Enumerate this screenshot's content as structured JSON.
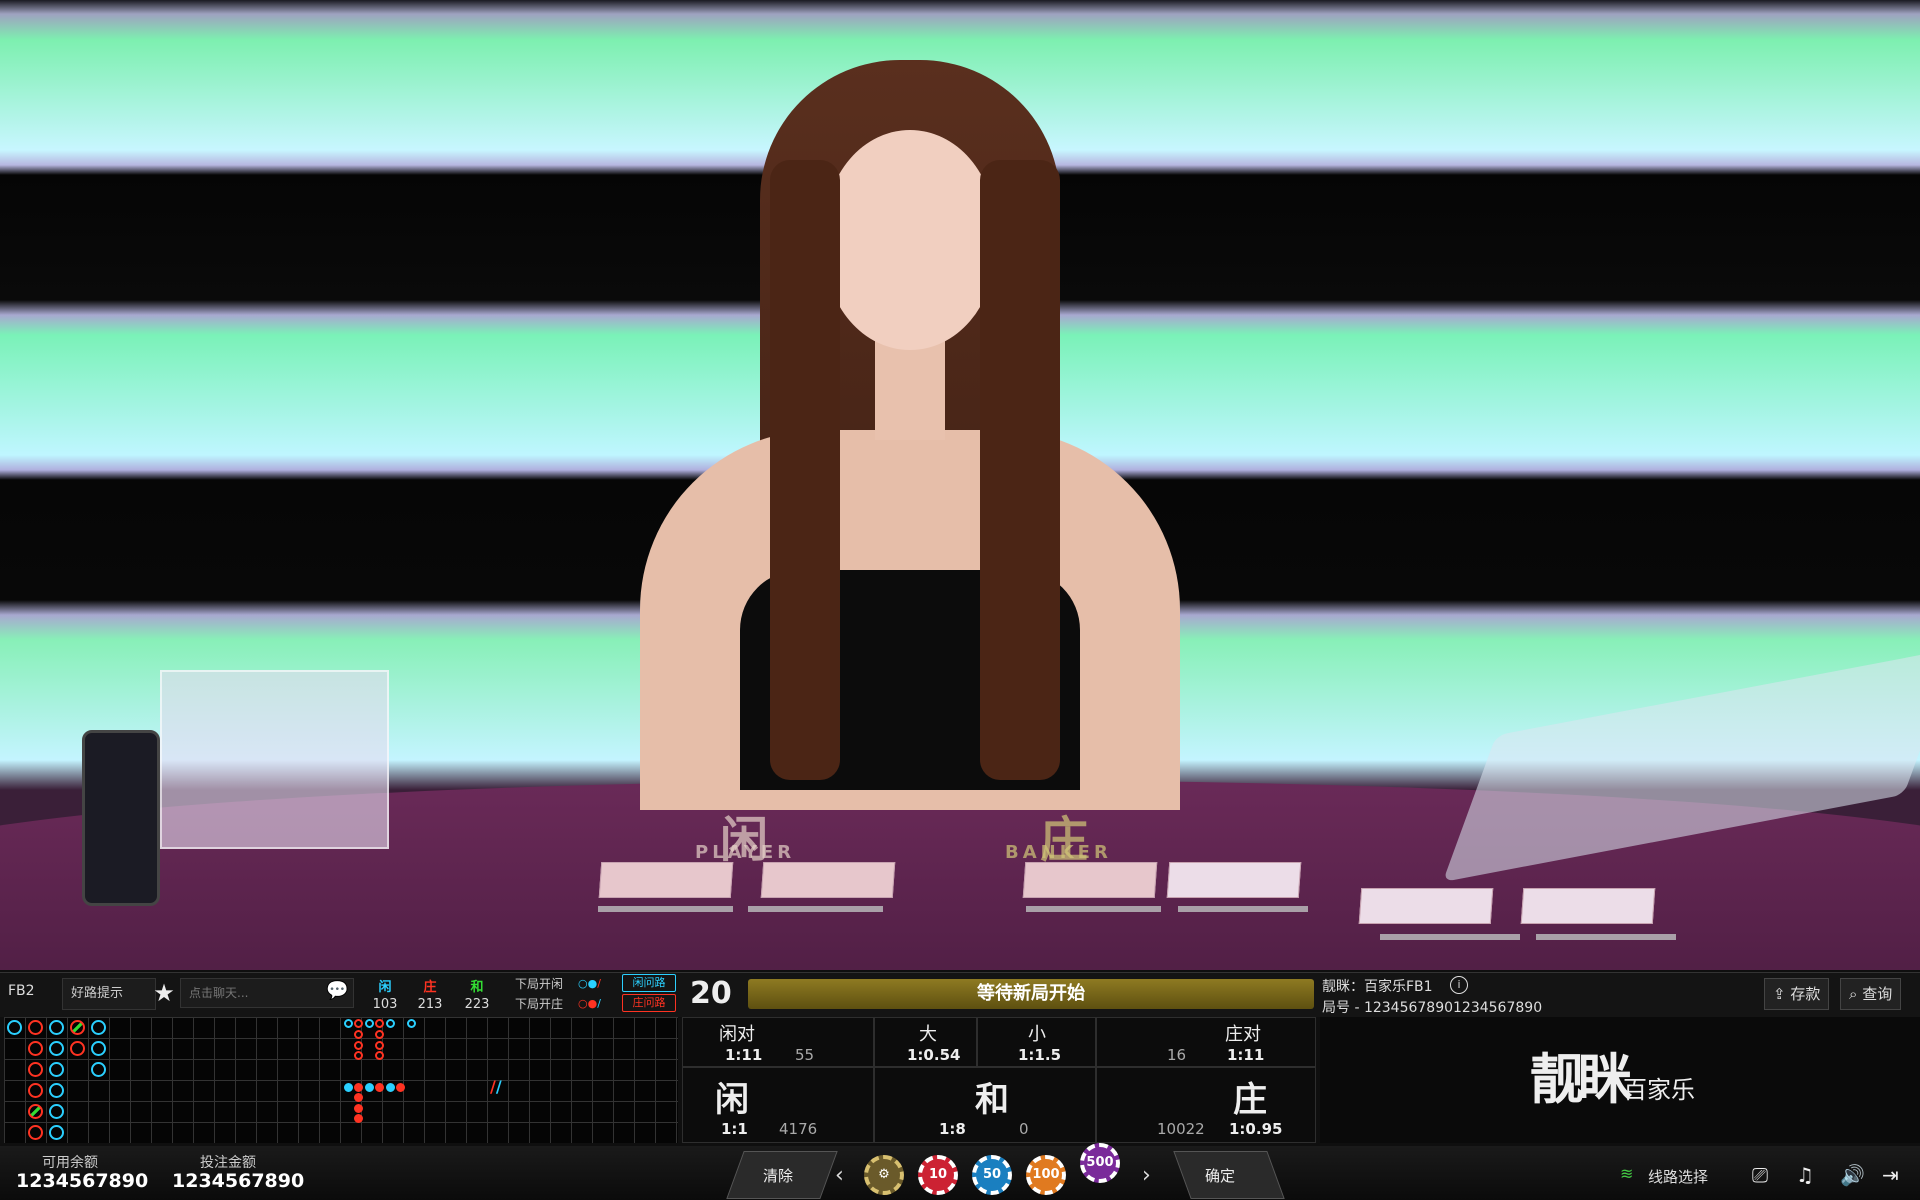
{
  "video": {
    "player_label": "闲",
    "player_en": "PLAYER",
    "banker_label": "庄",
    "banker_en": "BANKER"
  },
  "header": {
    "table_code": "FB2",
    "hint_label": "好路提示",
    "chat_placeholder": "点击聊天...",
    "stats": {
      "player_label": "闲",
      "player_count": "103",
      "banker_label": "庄",
      "banker_count": "213",
      "tie_label": "和",
      "tie_count": "223"
    },
    "next_player_label": "下局开闲",
    "next_banker_label": "下局开庄",
    "ask_player_btn": "闲问路",
    "ask_banker_btn": "庄问路",
    "countdown": "20",
    "status": "等待新局开始",
    "room_name": "靓眯：百家乐FB1",
    "round_id": "局号 - 12345678901234567890",
    "deposit_btn": "存款",
    "query_btn": "查询"
  },
  "bets": {
    "player_pair": {
      "label": "闲对",
      "odds": "1:11",
      "amount": "55"
    },
    "big": {
      "label": "大",
      "odds": "1:0.54"
    },
    "small": {
      "label": "小",
      "odds": "1:1.5"
    },
    "banker_pair": {
      "label": "庄对",
      "odds": "1:11",
      "amount": "16"
    },
    "player": {
      "label": "闲",
      "odds": "1:1",
      "amount": "4176"
    },
    "tie": {
      "label": "和",
      "odds": "1:8",
      "amount": "0"
    },
    "banker": {
      "label": "庄",
      "odds": "1:0.95",
      "amount": "10022"
    }
  },
  "logo": {
    "main": "靓眯",
    "sub": "百家乐"
  },
  "footer": {
    "balance_label": "可用余额",
    "balance_value": "1234567890",
    "bet_label": "投注金额",
    "bet_value": "1234567890",
    "clear_btn": "清除",
    "confirm_btn": "确定",
    "chips": [
      "10",
      "50",
      "100",
      "500"
    ],
    "line_select": "线路选择"
  },
  "colors": {
    "player": "#2ad0ff",
    "banker": "#ff3322",
    "tie": "#33dd33",
    "status_gold": "#8e7a22"
  }
}
